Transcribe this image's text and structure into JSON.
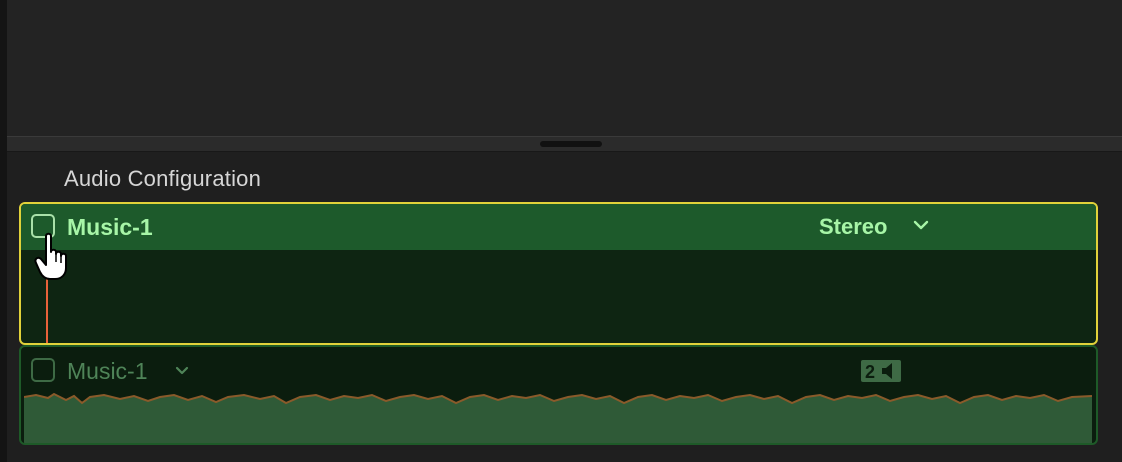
{
  "inspector": {
    "section_title": "Audio Configuration",
    "active_component": {
      "name": "Music-1",
      "channel_config": "Stereo",
      "enabled": false
    },
    "clip_component": {
      "name": "Music-1",
      "channel_count": "2",
      "enabled": false
    }
  },
  "icons": {
    "pointer": "pointing-hand-cursor-icon",
    "dropdown": "chevron-down-icon",
    "speaker": "speaker-icon"
  },
  "colors": {
    "selection_border": "#e1d23a",
    "active_header": "#1d5a2b",
    "active_text": "#a7f5a7",
    "playhead": "#e8623a",
    "waveform": "#2f5a37"
  }
}
